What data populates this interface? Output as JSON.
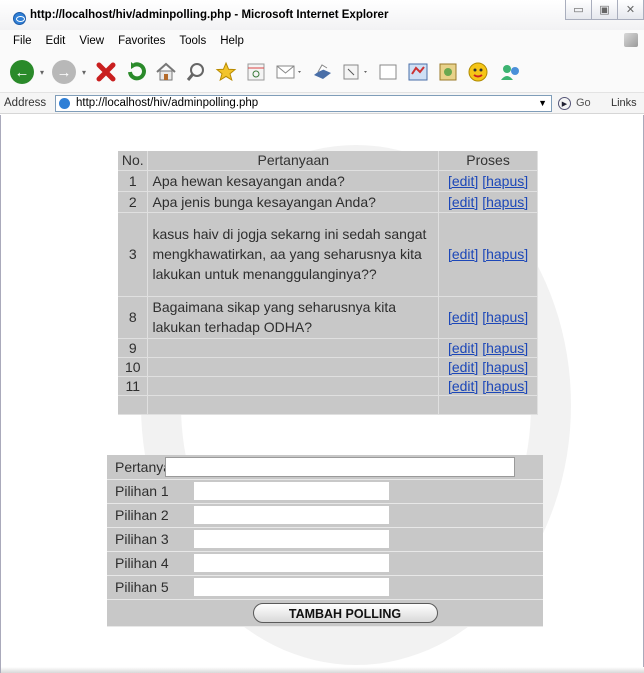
{
  "window": {
    "title": "http://localhost/hiv/adminpolling.php - Microsoft Internet Explorer",
    "minimize": "▭",
    "maximize": "▣",
    "close": "✕"
  },
  "menu": [
    "File",
    "Edit",
    "View",
    "Favorites",
    "Tools",
    "Help"
  ],
  "toolbar": {
    "icons": [
      "back-icon",
      "forward-icon",
      "stop-icon",
      "refresh-icon",
      "home-icon",
      "search-icon",
      "favorites-icon",
      "history-icon",
      "mail-icon",
      "print-icon",
      "edit-icon",
      "discuss-icon",
      "research-icon",
      "messenger-icon",
      "msn-icon",
      "contacts-icon"
    ]
  },
  "address": {
    "label": "Address",
    "url": "http://localhost/hiv/adminpolling.php",
    "go": "Go",
    "links": "Links"
  },
  "table": {
    "headers": {
      "no": "No.",
      "question": "Pertanyaan",
      "process": "Proses"
    },
    "rows": [
      {
        "no": "1",
        "question": "Apa hewan kesayangan anda?",
        "edit": "[edit]",
        "delete": "[hapus]"
      },
      {
        "no": "2",
        "question": "Apa jenis bunga kesayangan Anda?",
        "edit": "[edit]",
        "delete": "[hapus]"
      },
      {
        "no": "3",
        "question": "kasus haiv di jogja sekarng ini sedah sangat mengkhawatirkan, aa yang seharusnya kita lakukan untuk menanggulanginya??",
        "edit": "[edit]",
        "delete": "[hapus]"
      },
      {
        "no": "8",
        "question": "Bagaimana sikap yang seharusnya kita lakukan terhadap ODHA?",
        "edit": "[edit]",
        "delete": "[hapus]"
      },
      {
        "no": "9",
        "question": "",
        "edit": "[edit]",
        "delete": "[hapus]"
      },
      {
        "no": "10",
        "question": "",
        "edit": "[edit]",
        "delete": "[hapus]"
      },
      {
        "no": "11",
        "question": "",
        "edit": "[edit]",
        "delete": "[hapus]"
      }
    ]
  },
  "form": {
    "question_label": "Pertanyaan",
    "question_value": "",
    "options": [
      {
        "label": "Pilihan 1",
        "value": ""
      },
      {
        "label": "Pilihan 2",
        "value": ""
      },
      {
        "label": "Pilihan 3",
        "value": ""
      },
      {
        "label": "Pilihan 4",
        "value": ""
      },
      {
        "label": "Pilihan 5",
        "value": ""
      }
    ],
    "submit_label": "TAMBAH POLLING"
  }
}
